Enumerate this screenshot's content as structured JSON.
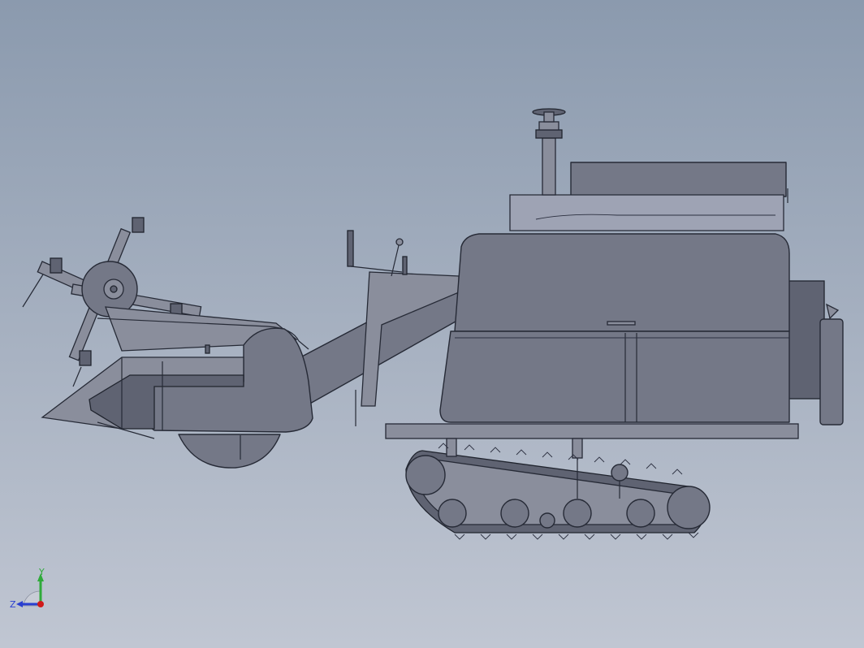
{
  "viewport": {
    "background_top": "#8b9aae",
    "background_bottom": "#c0c6d2",
    "model_fill": "#747887",
    "edge_color": "#262a36"
  },
  "triad": {
    "y_label": "Y",
    "z_label": "Z",
    "y_color": "#2faa3a",
    "z_color": "#2a3fd0",
    "x_color": "#d01a1a"
  }
}
